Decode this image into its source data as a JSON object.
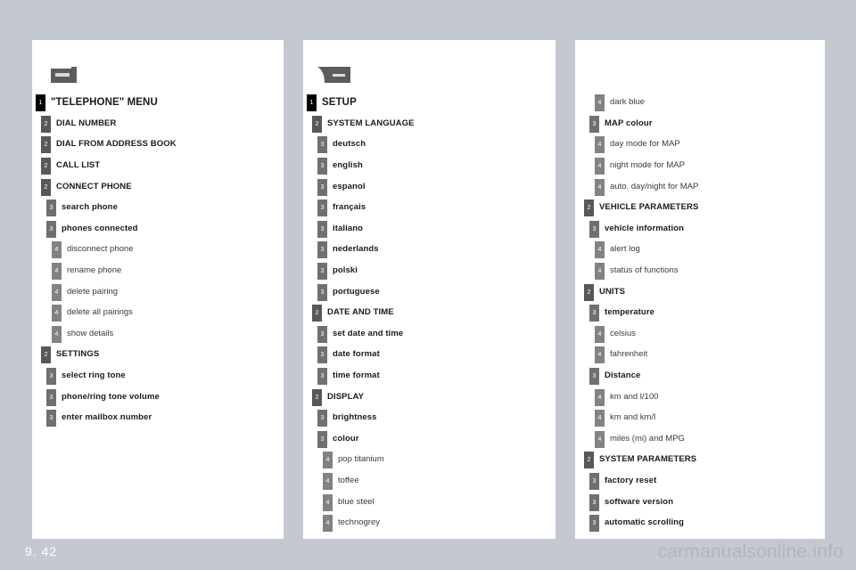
{
  "page": {
    "number": "9. 42",
    "watermark": "carmanualsonline.info",
    "background_color": "#c3c8d1",
    "panel_color": "#ffffff",
    "badge_colors": {
      "level1": "#000000",
      "level2": "#58585a",
      "level3": "#6f7072",
      "level4": "#818285"
    }
  },
  "columns": [
    {
      "icon": "phone-tab-icon",
      "icon_label": "PHONE",
      "rows": [
        {
          "level": 1,
          "badge": "1",
          "label": "\"TELEPHONE\" MENU"
        },
        {
          "level": 2,
          "badge": "2",
          "label": "DIAL NUMBER"
        },
        {
          "level": 2,
          "badge": "2",
          "label": "DIAL FROM ADDRESS BOOK"
        },
        {
          "level": 2,
          "badge": "2",
          "label": "CALL LIST"
        },
        {
          "level": 2,
          "badge": "2",
          "label": "CONNECT PHONE"
        },
        {
          "level": 3,
          "badge": "3",
          "label": "search phone"
        },
        {
          "level": 3,
          "badge": "3",
          "label": "phones connected"
        },
        {
          "level": 4,
          "badge": "4",
          "label": "disconnect phone"
        },
        {
          "level": 4,
          "badge": "4",
          "label": "rename phone"
        },
        {
          "level": 4,
          "badge": "4",
          "label": "delete pairing"
        },
        {
          "level": 4,
          "badge": "4",
          "label": "delete all pairings"
        },
        {
          "level": 4,
          "badge": "4",
          "label": "show details"
        },
        {
          "level": 2,
          "badge": "2",
          "label": "SETTINGS"
        },
        {
          "level": 3,
          "badge": "3",
          "label": "select ring tone"
        },
        {
          "level": 3,
          "badge": "3",
          "label": "phone/ring tone volume"
        },
        {
          "level": 3,
          "badge": "3",
          "label": "enter mailbox number"
        }
      ]
    },
    {
      "icon": "setup-tab-icon",
      "icon_label": "SETUP",
      "rows": [
        {
          "level": 1,
          "badge": "1",
          "label": "SETUP"
        },
        {
          "level": 2,
          "badge": "2",
          "label": "SYSTEM LANGUAGE"
        },
        {
          "level": 3,
          "badge": "3",
          "label": "deutsch"
        },
        {
          "level": 3,
          "badge": "3",
          "label": "english"
        },
        {
          "level": 3,
          "badge": "3",
          "label": "espanol"
        },
        {
          "level": 3,
          "badge": "3",
          "label": "français"
        },
        {
          "level": 3,
          "badge": "3",
          "label": "italiano"
        },
        {
          "level": 3,
          "badge": "3",
          "label": "nederlands"
        },
        {
          "level": 3,
          "badge": "3",
          "label": "polski"
        },
        {
          "level": 3,
          "badge": "3",
          "label": "portuguese"
        },
        {
          "level": 2,
          "badge": "2",
          "label": "DATE AND TIME"
        },
        {
          "level": 3,
          "badge": "3",
          "label": "set date and time"
        },
        {
          "level": 3,
          "badge": "3",
          "label": "date format"
        },
        {
          "level": 3,
          "badge": "3",
          "label": "time format"
        },
        {
          "level": 2,
          "badge": "2",
          "label": "DISPLAY"
        },
        {
          "level": 3,
          "badge": "3",
          "label": "brightness"
        },
        {
          "level": 3,
          "badge": "3",
          "label": "colour"
        },
        {
          "level": 4,
          "badge": "4",
          "label": "pop titanium"
        },
        {
          "level": 4,
          "badge": "4",
          "label": "toffee"
        },
        {
          "level": 4,
          "badge": "4",
          "label": "blue steel"
        },
        {
          "level": 4,
          "badge": "4",
          "label": "technogrey"
        }
      ]
    },
    {
      "icon": null,
      "icon_label": null,
      "rows": [
        {
          "level": 4,
          "badge": "4",
          "label": "dark blue"
        },
        {
          "level": 3,
          "badge": "3",
          "label": "MAP colour"
        },
        {
          "level": 4,
          "badge": "4",
          "label": "day mode for MAP"
        },
        {
          "level": 4,
          "badge": "4",
          "label": "night mode for MAP"
        },
        {
          "level": 4,
          "badge": "4",
          "label": "auto. day/night for MAP"
        },
        {
          "level": 2,
          "badge": "2",
          "label": "VEHICLE PARAMETERS"
        },
        {
          "level": 3,
          "badge": "3",
          "label": "vehicle information"
        },
        {
          "level": 4,
          "badge": "4",
          "label": "alert log"
        },
        {
          "level": 4,
          "badge": "4",
          "label": "status of functions"
        },
        {
          "level": 2,
          "badge": "2",
          "label": "UNITS"
        },
        {
          "level": 3,
          "badge": "3",
          "label": "temperature"
        },
        {
          "level": 4,
          "badge": "4",
          "label": "celsius"
        },
        {
          "level": 4,
          "badge": "4",
          "label": "fahrenheit"
        },
        {
          "level": 3,
          "badge": "3",
          "label": "Distance"
        },
        {
          "level": 4,
          "badge": "4",
          "label": "km and l/100"
        },
        {
          "level": 4,
          "badge": "4",
          "label": "km and km/l"
        },
        {
          "level": 4,
          "badge": "4",
          "label": "miles (mi) and MPG"
        },
        {
          "level": 2,
          "badge": "2",
          "label": "SYSTEM PARAMETERS"
        },
        {
          "level": 3,
          "badge": "3",
          "label": "factory reset"
        },
        {
          "level": 3,
          "badge": "3",
          "label": "software version"
        },
        {
          "level": 3,
          "badge": "3",
          "label": "automatic scrolling"
        }
      ]
    }
  ]
}
